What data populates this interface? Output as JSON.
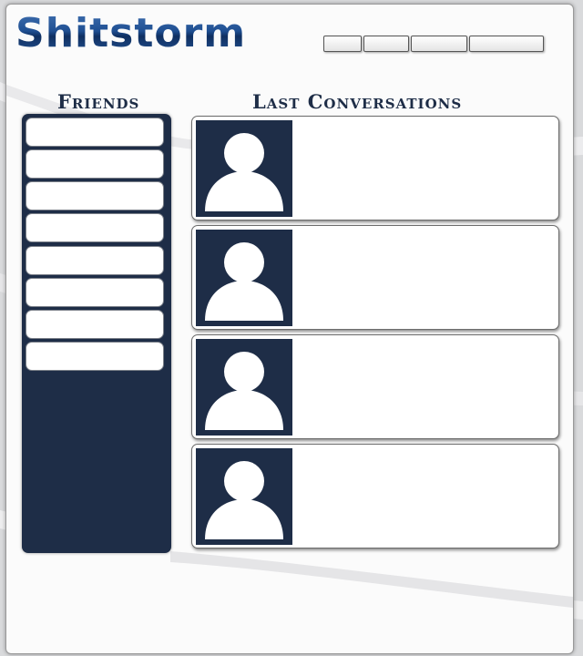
{
  "app": {
    "logo_text": "Shitstorm"
  },
  "nav": {
    "buttons": [
      "",
      "",
      "",
      ""
    ]
  },
  "friends": {
    "title": "Friends",
    "items": [
      "",
      "",
      "",
      "",
      "",
      "",
      "",
      ""
    ]
  },
  "conversations": {
    "title": "Last Conversations",
    "items": [
      {
        "text": ""
      },
      {
        "text": ""
      },
      {
        "text": ""
      },
      {
        "text": ""
      }
    ]
  },
  "colors": {
    "panel": "#1e2d47",
    "logo_blue": "#1f4f92",
    "frame": "#fbfbfb",
    "background": "#d9dadc"
  },
  "icons": {
    "avatar": "user-silhouette-icon"
  }
}
